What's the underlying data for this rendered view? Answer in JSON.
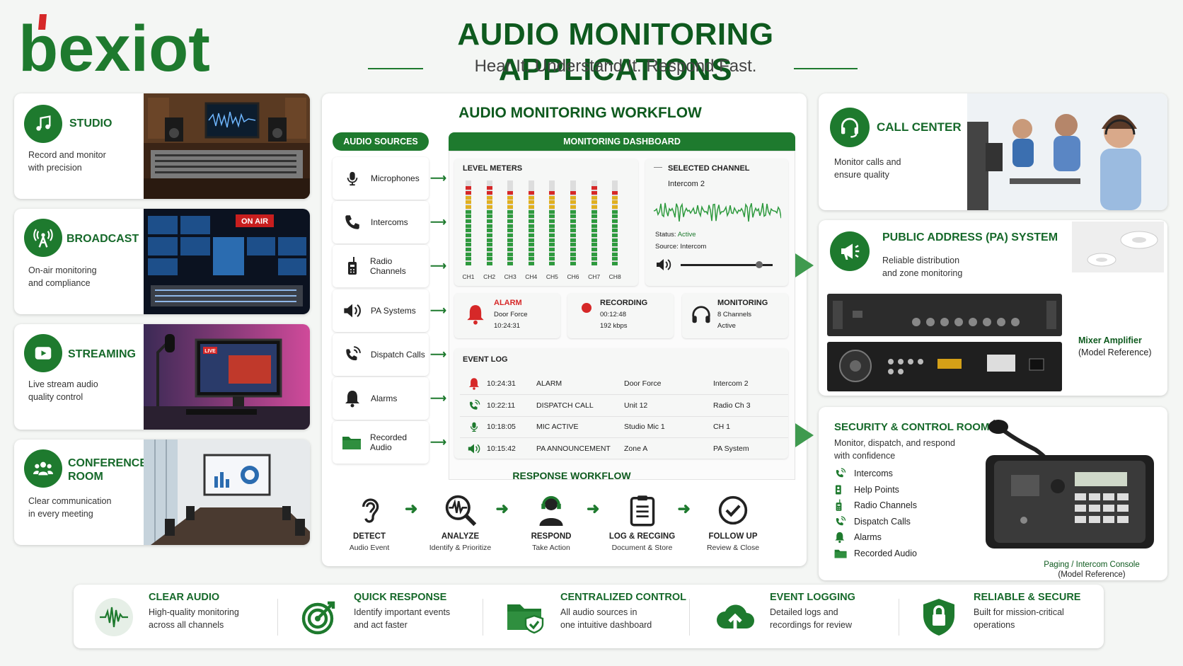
{
  "header": {
    "logo_text": "bexiot",
    "title": "AUDIO MONITORING APPLICATIONS",
    "subtitle": "Hear It. Understand It. Respond Fast."
  },
  "applications_left": [
    {
      "title": "STUDIO",
      "desc1": "Record and monitor",
      "desc2": "with precision",
      "icon": "music-note-icon"
    },
    {
      "title": "BROADCAST",
      "desc1": "On-air monitoring",
      "desc2": "and compliance",
      "icon": "antenna-icon",
      "photo_badge": "ON AIR"
    },
    {
      "title": "STREAMING",
      "desc1": "Live stream audio",
      "desc2": "quality control",
      "icon": "play-icon",
      "photo_badge": "LIVE"
    },
    {
      "title1": "CONFERENCE",
      "title2": "ROOM",
      "desc1": "Clear communication",
      "desc2": "in every meeting",
      "icon": "people-icon"
    }
  ],
  "workflow": {
    "title": "AUDIO MONITORING WORKFLOW",
    "sources_label": "AUDIO SOURCES",
    "dashboard_label": "MONITORING DASHBOARD",
    "sources": [
      "Microphones",
      "Intercoms",
      "Radio Channels",
      "PA Systems",
      "Dispatch Calls",
      "Alarms",
      "Recorded Audio"
    ],
    "level_meters": {
      "title": "LEVEL METERS",
      "channels": [
        "CH1",
        "CH2",
        "CH3",
        "CH4",
        "CH5",
        "CH6",
        "CH7",
        "CH8"
      ],
      "levels": [
        0.9,
        0.9,
        0.85,
        0.85,
        0.85,
        0.85,
        0.9,
        0.85
      ]
    },
    "selected_channel": {
      "title": "SELECTED CHANNEL",
      "name": "Intercom 2",
      "status_label": "Status:",
      "status_value": "Active",
      "source_label": "Source:",
      "source_value": "Intercom",
      "volume": 0.85
    },
    "status_tiles": [
      {
        "title": "ALARM",
        "line1": "Door Force",
        "line2": "10:24:31"
      },
      {
        "title": "RECORDING",
        "line1": "00:12:48",
        "line2": "192 kbps"
      },
      {
        "title": "MONITORING",
        "line1": "8 Channels",
        "line2": "Active"
      }
    ],
    "event_log": {
      "title": "EVENT LOG",
      "rows": [
        {
          "icon": "bell-icon",
          "time": "10:24:31",
          "event": "ALARM",
          "detail": "Door Force",
          "source": "Intercom 2"
        },
        {
          "icon": "phone-call-icon",
          "time": "10:22:11",
          "event": "DISPATCH CALL",
          "detail": "Unit 12",
          "source": "Radio Ch 3"
        },
        {
          "icon": "microphone-icon",
          "time": "10:18:05",
          "event": "MIC ACTIVE",
          "detail": "Studio Mic 1",
          "source": "CH 1"
        },
        {
          "icon": "speaker-icon",
          "time": "10:15:42",
          "event": "PA ANNOUNCEMENT",
          "detail": "Zone A",
          "source": "PA System"
        }
      ]
    },
    "response": {
      "title": "RESPONSE WORKFLOW",
      "steps": [
        {
          "title": "DETECT",
          "desc": "Audio Event"
        },
        {
          "title": "ANALYZE",
          "desc": "Identify & Prioritize"
        },
        {
          "title": "RESPOND",
          "desc": "Take Action"
        },
        {
          "title": "LOG & RECGING",
          "desc": "Document & Store"
        },
        {
          "title": "FOLLOW UP",
          "desc": "Review & Close"
        }
      ]
    }
  },
  "applications_right": {
    "call_center": {
      "title": "CALL CENTER",
      "desc1": "Monitor calls and",
      "desc2": "ensure quality"
    },
    "pa_system": {
      "title": "PUBLIC ADDRESS (PA) SYSTEM",
      "desc1": "Reliable distribution",
      "desc2": "and zone monitoring",
      "device1": "Mixer Amplifier",
      "device2": "(Model Reference)"
    },
    "security": {
      "title": "SECURITY & CONTROL ROOM",
      "desc1": "Monitor, dispatch, and respond",
      "desc2": "with confidence",
      "items": [
        "Intercoms",
        "Help Points",
        "Radio Channels",
        "Dispatch Calls",
        "Alarms",
        "Recorded Audio"
      ],
      "device1": "Paging / Intercom Console",
      "device2": "(Model Reference)"
    }
  },
  "benefits": [
    {
      "title": "CLEAR AUDIO",
      "desc1": "High-quality monitoring",
      "desc2": "across all channels"
    },
    {
      "title": "QUICK RESPONSE",
      "desc1": "Identify important events",
      "desc2": "and act faster"
    },
    {
      "title": "CENTRALIZED CONTROL",
      "desc1": "All audio sources in",
      "desc2": "one intuitive dashboard"
    },
    {
      "title": "EVENT LOGGING",
      "desc1": "Detailed logs and",
      "desc2": "recordings for review"
    },
    {
      "title": "RELIABLE & SECURE",
      "desc1": "Built for mission-critical",
      "desc2": "operations"
    }
  ],
  "colors": {
    "brand_green": "#1e7a2e",
    "dark_green": "#0e5a1e",
    "alarm_red": "#d62828",
    "logo_red": "#d62828"
  }
}
